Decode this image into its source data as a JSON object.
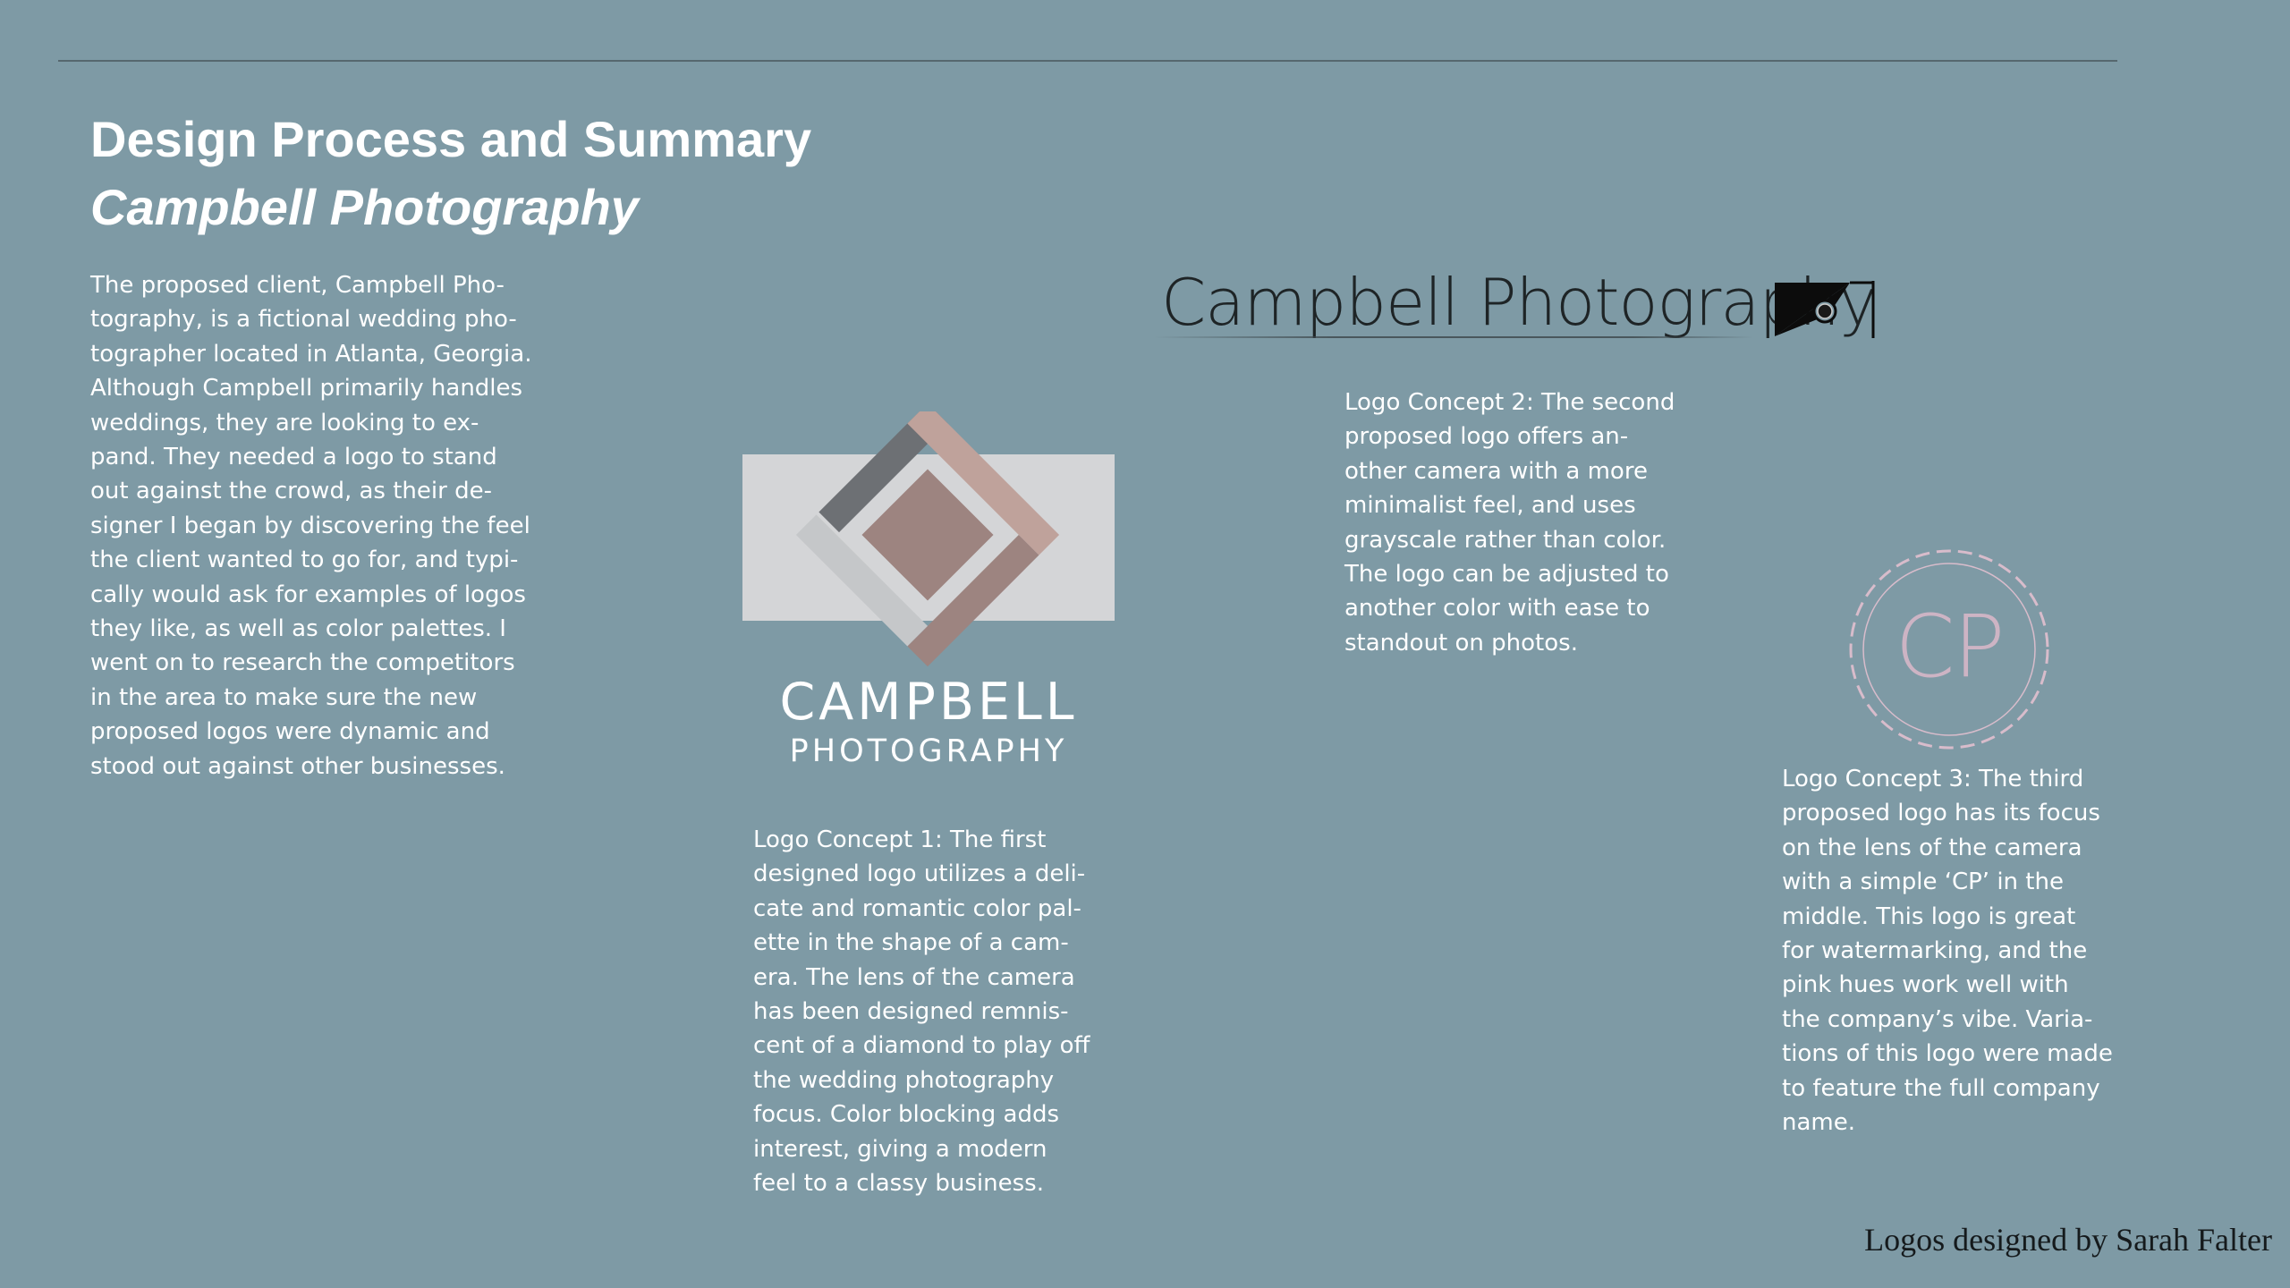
{
  "header": {
    "title": "Design Process and Summary",
    "subtitle": "Campbell Photography"
  },
  "intro": {
    "text": "The proposed client, Campbell Pho-\ntography, is a fictional wedding pho-\ntographer located in Atlanta, Georgia.\nAlthough Campbell primarily handles\nweddings, they are looking to ex-\npand. They needed a logo to stand\nout against the crowd, as their de-\nsigner I began by discovering the feel\nthe client wanted to go for, and typi-\ncally would ask for examples of logos\nthey like, as well as color palettes. I\nwent on to research the competitors\nin the area to make sure the new\nproposed logos were dynamic and\nstood out against other businesses."
  },
  "logo1": {
    "name": "CAMPBELL",
    "sub": "PHOTOGRAPHY",
    "description": "Logo Concept 1: The first\ndesigned logo utilizes a deli-\ncate and romantic color pal-\nette in the shape of a cam-\nera. The lens of the camera\nhas been designed remnis-\ncent of a diamond to play off\nthe wedding photography\nfocus. Color blocking adds\ninterest, giving a modern\nfeel to a classy business."
  },
  "logo2": {
    "wordmark": "Campbell Photography",
    "description": "Logo Concept 2: The second\nproposed logo offers an-\nother camera with a more\nminimalist feel, and uses\ngrayscale rather than color.\nThe logo can be adjusted to\nanother color with ease to\nstandout on photos."
  },
  "logo3": {
    "monogram": "CP",
    "description": "Logo Concept 3: The third\nproposed logo has its focus\non the lens of the camera\nwith a simple ‘CP’ in the\nmiddle. This logo is great\nfor watermarking, and the\npink hues work well with\nthe company’s vibe. Varia-\ntions of this logo were made\nto feature the full company\nname."
  },
  "footer": {
    "credit": "Logos designed by Sarah Falter"
  },
  "colors": {
    "background": "#7e9aa5",
    "rose": "#bfa29b",
    "mauve": "#9d8480",
    "charcoal": "#6d7074",
    "light_gray": "#c5c7c9",
    "panel": "#d4d5d7",
    "pink_ring": "#d8bccb"
  }
}
